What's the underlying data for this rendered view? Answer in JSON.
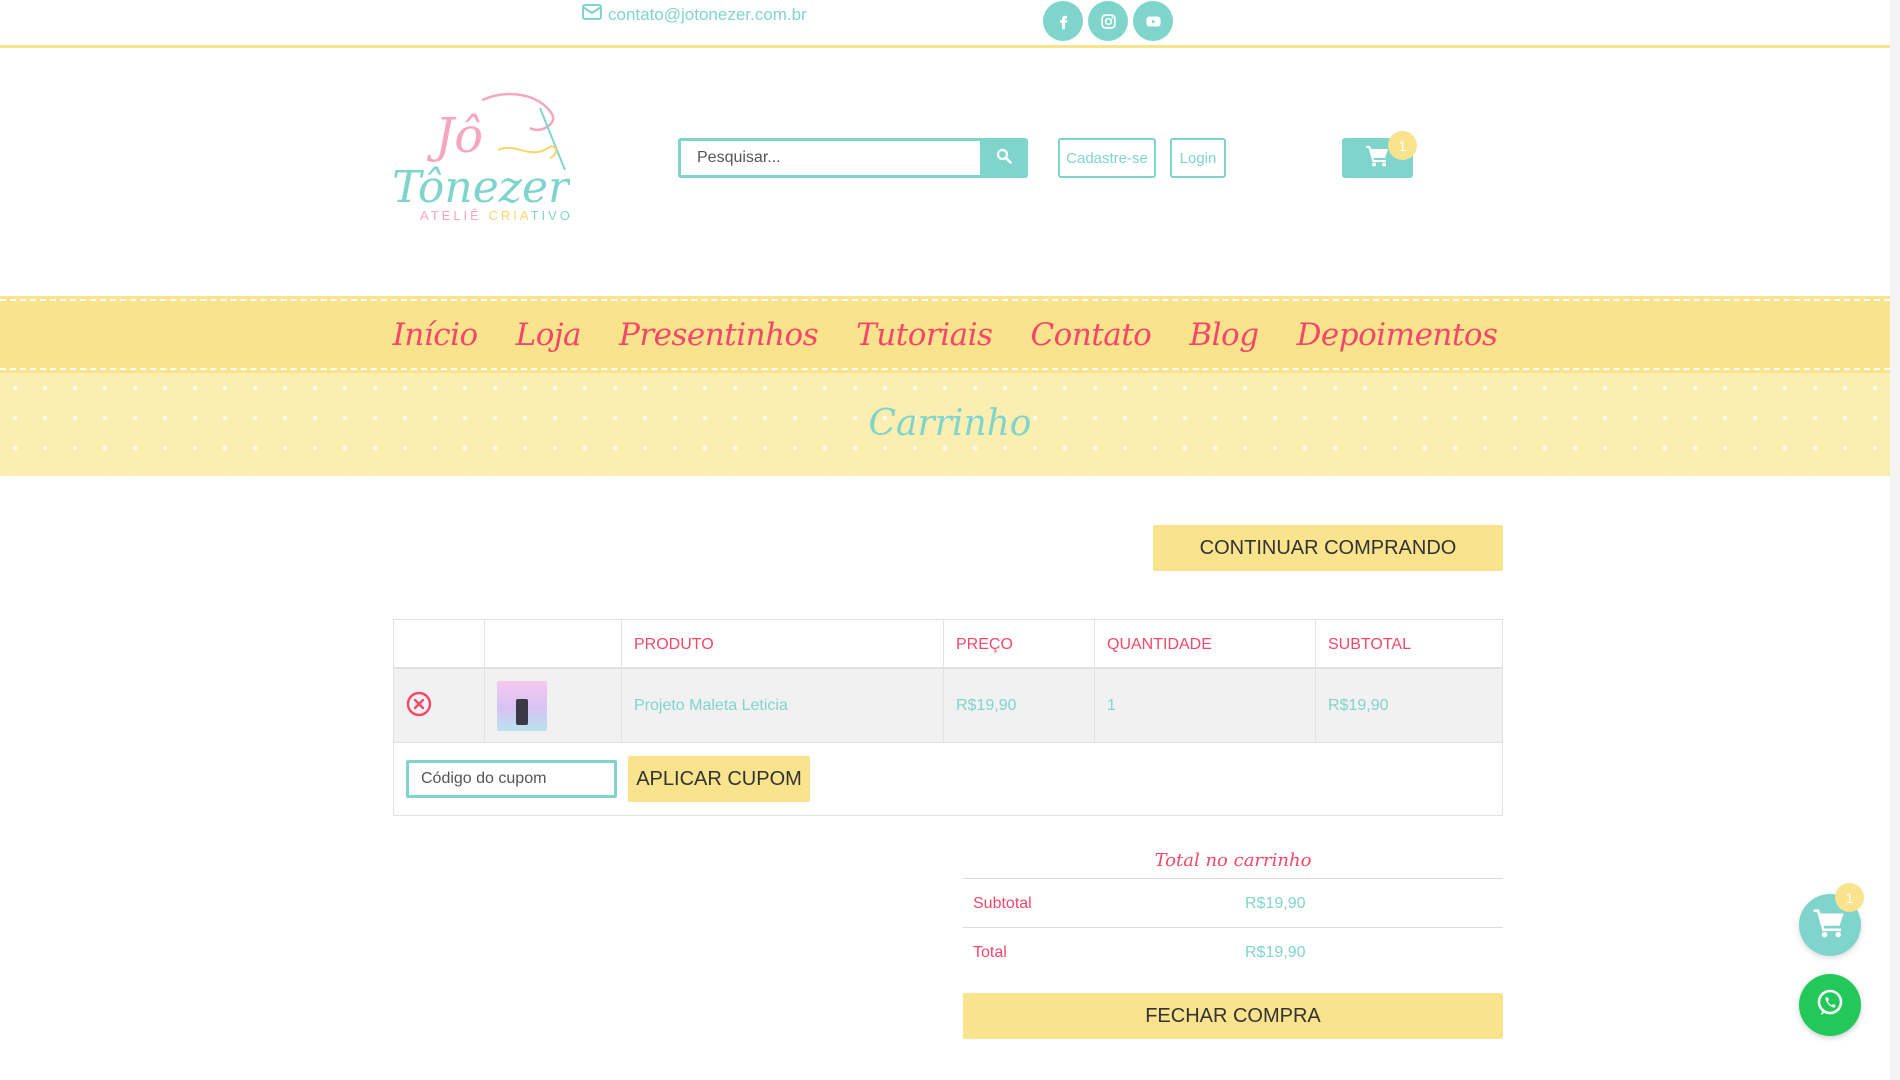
{
  "topbar": {
    "email": "contato@jotonezer.com.br",
    "social": [
      {
        "icon": "facebook-icon"
      },
      {
        "icon": "instagram-icon"
      },
      {
        "icon": "youtube-icon"
      }
    ]
  },
  "brand": {
    "logo_line1": "Jô",
    "logo_line2": "Tônezer",
    "logo_caption_1": "ATELIÊ ",
    "logo_caption_2": "CRIA",
    "logo_caption_3": "TIVO"
  },
  "header": {
    "search_placeholder": "Pesquisar...",
    "register_label": "Cadastre-se",
    "login_label": "Login",
    "cart_count": "1"
  },
  "nav": {
    "items": [
      {
        "label": "Início"
      },
      {
        "label": "Loja"
      },
      {
        "label": "Presentinhos"
      },
      {
        "label": "Tutoriais"
      },
      {
        "label": "Contato"
      },
      {
        "label": "Blog"
      },
      {
        "label": "Depoimentos"
      }
    ]
  },
  "page_title": "Carrinho",
  "continue_label": "CONTINUAR COMPRANDO",
  "cart_table": {
    "headers": [
      "PRODUTO",
      "PREÇO",
      "QUANTIDADE",
      "SUBTOTAL"
    ],
    "rows": [
      {
        "product": "Projeto Maleta Leticia",
        "price": "R$19,90",
        "quantity": "1",
        "subtotal": "R$19,90"
      }
    ],
    "coupon_placeholder": "Código do cupom",
    "apply_coupon_label": "APLICAR CUPOM"
  },
  "totals": {
    "title": "Total no carrinho",
    "subtotal_label": "Subtotal",
    "subtotal_value": "R$19,90",
    "total_label": "Total",
    "total_value": "R$19,90",
    "checkout_label": "FECHAR COMPRA"
  },
  "floating": {
    "cart_count": "1"
  },
  "colors": {
    "teal": "#7fd5cc",
    "pink": "#f5476a",
    "yellow": "#f9e38c",
    "whatsapp": "#22c95a"
  }
}
